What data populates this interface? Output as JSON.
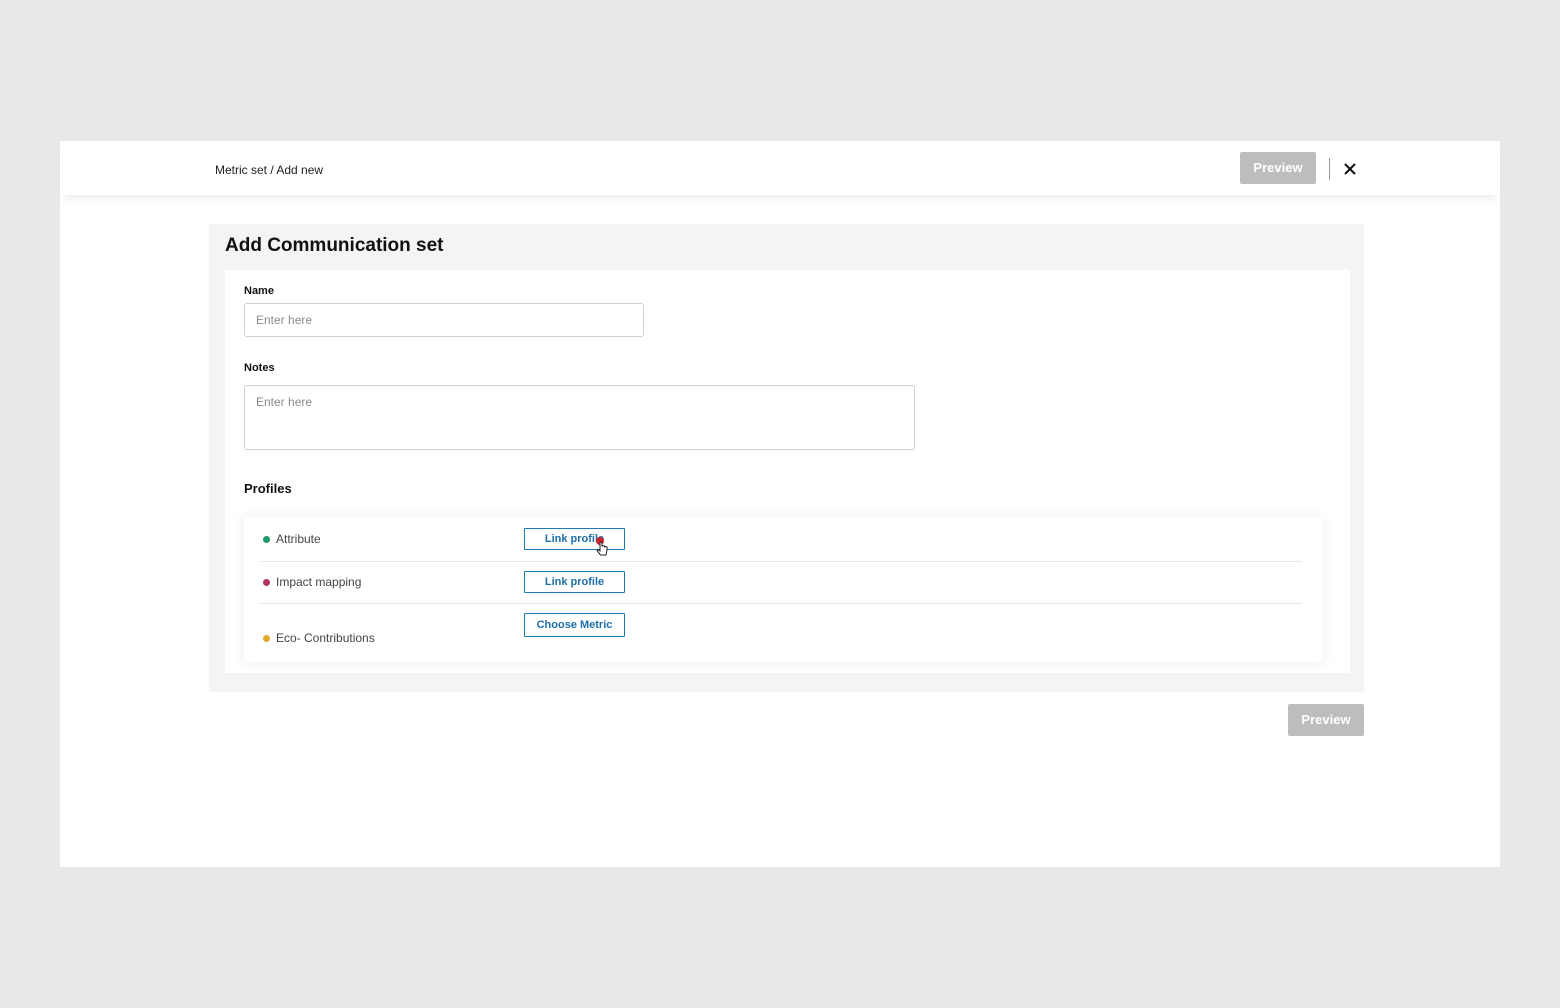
{
  "header": {
    "breadcrumb": "Metric set / Add new",
    "preview_label": "Preview"
  },
  "form": {
    "title": "Add Communication set",
    "name_label": "Name",
    "name_placeholder": "Enter here",
    "name_value": "",
    "notes_label": "Notes",
    "notes_placeholder": "Enter here",
    "notes_value": "",
    "profiles_title": "Profiles",
    "profiles": [
      {
        "label": "Attribute",
        "button": "Link profile",
        "dot_color": "#1f9a6a"
      },
      {
        "label": "Impact mapping",
        "button": "Link profile",
        "dot_color": "#b0345a"
      },
      {
        "label": "Eco- Contributions",
        "button": "Choose Metric",
        "dot_color": "#e0a92a"
      }
    ]
  },
  "footer": {
    "preview_label": "Preview"
  },
  "icons": {
    "close": "close-icon",
    "cursor": "hand-pointer-icon"
  },
  "colors": {
    "accent": "#1f6fa8",
    "disabled_button": "#bdbdbd"
  }
}
